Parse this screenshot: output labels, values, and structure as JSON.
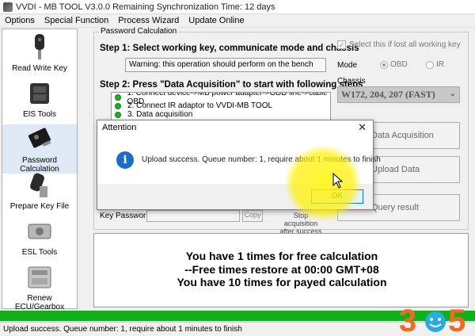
{
  "window": {
    "title": "VVDI - MB TOOL V3.0.0   Remaining Synchronization Time: 12 days"
  },
  "menu": [
    "Options",
    "Special Function",
    "Process Wizard",
    "Update Online"
  ],
  "sidebar": {
    "items": [
      {
        "label": "Read Write Key",
        "icon": "car-key-icon"
      },
      {
        "label": "EIS Tools",
        "icon": "ignition-switch-icon"
      },
      {
        "label": "Password Calculation",
        "icon": "key-chip-icon",
        "active": true
      },
      {
        "label": "Prepare Key File",
        "icon": "key-file-icon"
      },
      {
        "label": "ESL Tools",
        "icon": "steering-lock-icon"
      },
      {
        "label": "Renew ECU/Gearbox",
        "icon": "ecu-module-icon"
      }
    ]
  },
  "password_calc": {
    "group_title": "Password Calculation",
    "step1": "Step 1: Select working key, communicate mode and chassis",
    "warning": "Warning: this operation should perform on the bench",
    "step2": "Step 2: Press \"Data Acquisition\" to start with following steps",
    "checklist": [
      "1. Connect device->MB power adapter->OBD line->cable OBD",
      "2. Connect IR adaptor to VVDI-MB TOOL",
      "3. Data acquisition"
    ],
    "lost_keys_checkbox": "Select this if lost all working key",
    "mode_label": "Mode",
    "mode_options": [
      "OBD",
      "IR"
    ],
    "mode_selected": "OBD",
    "chassis_label": "Chassis",
    "chassis_value": "W172, 204, 207 (FAST)",
    "buttons": {
      "data_acquisition": "Data Acquisition",
      "upload_data": "Upload Data",
      "query_result": "Query result"
    },
    "key_password_label": "Key Password",
    "copy_label": "Copy",
    "stop_label_1": "Stop acquisition",
    "stop_label_2": "after success"
  },
  "info": {
    "line1": "You have 1 times for free calculation",
    "line2": "--Free times restore at 00:00 GMT+08",
    "line3": "You have 10 times for payed calculation"
  },
  "progress_pct": 100,
  "status": "Upload success. Queue number: 1, require about 1 minutes to finish",
  "dialog": {
    "title": "Attention",
    "message": "Upload success. Queue number: 1, require about 1 minutes to finish",
    "ok": "OK"
  },
  "colors": {
    "progress": "#11b01a",
    "accent": "#0078d7",
    "info_icon": "#1c6ec4"
  }
}
